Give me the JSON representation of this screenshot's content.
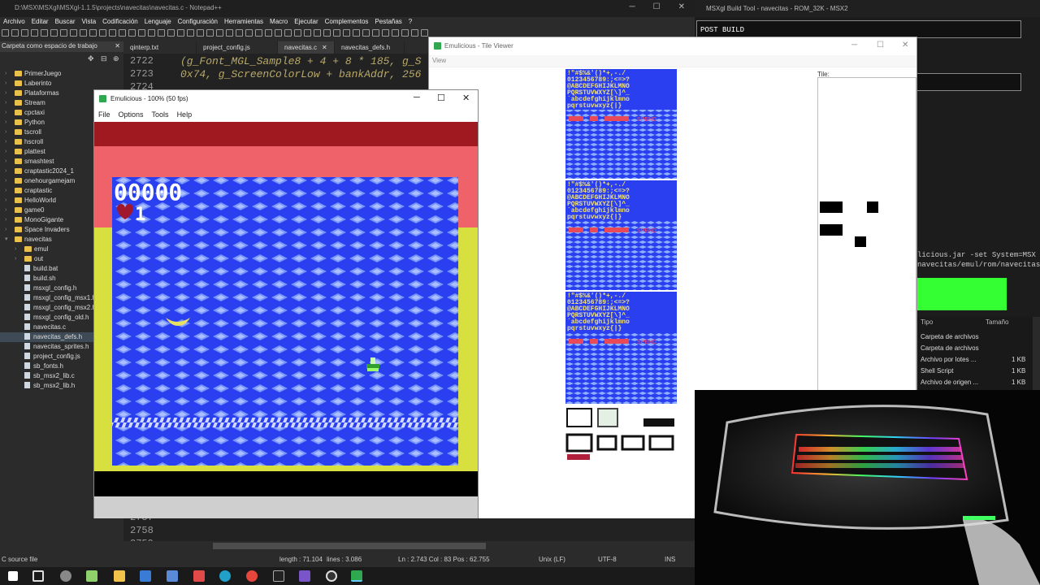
{
  "notepad": {
    "title": "D:\\MSX\\MSXgl\\MSXgl-1.1.5\\projects\\navecitas\\navecitas.c - Notepad++",
    "menu": [
      "Archivo",
      "Editar",
      "Buscar",
      "Vista",
      "Codificación",
      "Lenguaje",
      "Configuración",
      "Herramientas",
      "Macro",
      "Ejecutar",
      "Complementos",
      "Pestañas",
      "?"
    ],
    "workspace_title": "Carpeta como espacio de trabajo",
    "tree": [
      {
        "label": "PrimerJuego",
        "type": "folder",
        "level": 0
      },
      {
        "label": "Laberinto",
        "type": "folder",
        "level": 0
      },
      {
        "label": "Plataformas",
        "type": "folder",
        "level": 0
      },
      {
        "label": "Stream",
        "type": "folder",
        "level": 0
      },
      {
        "label": "cpctaxi",
        "type": "folder",
        "level": 0
      },
      {
        "label": "Python",
        "type": "folder",
        "level": 0
      },
      {
        "label": "tscroll",
        "type": "folder",
        "level": 0
      },
      {
        "label": "hscroll",
        "type": "folder",
        "level": 0
      },
      {
        "label": "plattest",
        "type": "folder",
        "level": 0
      },
      {
        "label": "smashtest",
        "type": "folder",
        "level": 0
      },
      {
        "label": "craptastic2024_1",
        "type": "folder",
        "level": 0
      },
      {
        "label": "onehourgamejam",
        "type": "folder",
        "level": 0
      },
      {
        "label": "craptastic",
        "type": "folder",
        "level": 0
      },
      {
        "label": "HelloWorld",
        "type": "folder",
        "level": 0
      },
      {
        "label": "game0",
        "type": "folder",
        "level": 0
      },
      {
        "label": "MonoGigante",
        "type": "folder",
        "level": 0
      },
      {
        "label": "Space Invaders",
        "type": "folder",
        "level": 0
      },
      {
        "label": "navecitas",
        "type": "folder",
        "level": 0,
        "open": true
      },
      {
        "label": "emul",
        "type": "folder",
        "level": 1
      },
      {
        "label": "out",
        "type": "folder",
        "level": 1
      },
      {
        "label": "build.bat",
        "type": "file",
        "level": 1
      },
      {
        "label": "build.sh",
        "type": "file",
        "level": 1
      },
      {
        "label": "msxgl_config.h",
        "type": "file",
        "level": 1
      },
      {
        "label": "msxgl_config_msx1.h",
        "type": "file",
        "level": 1
      },
      {
        "label": "msxgl_config_msx2.h",
        "type": "file",
        "level": 1
      },
      {
        "label": "msxgl_config_old.h",
        "type": "file",
        "level": 1
      },
      {
        "label": "navecitas.c",
        "type": "file",
        "level": 1
      },
      {
        "label": "navecitas_defs.h",
        "type": "file",
        "level": 1,
        "selected": true
      },
      {
        "label": "navecitas_sprites.h",
        "type": "file",
        "level": 1
      },
      {
        "label": "project_config.js",
        "type": "file",
        "level": 1
      },
      {
        "label": "sb_fonts.h",
        "type": "file",
        "level": 1
      },
      {
        "label": "sb_msx2_lib.c",
        "type": "file",
        "level": 1
      },
      {
        "label": "sb_msx2_lib.h",
        "type": "file",
        "level": 1
      }
    ],
    "tabs": [
      {
        "label": "qinterp.txt",
        "active": false
      },
      {
        "label": "project_config.js",
        "active": false
      },
      {
        "label": "navecitas.c",
        "active": true
      },
      {
        "label": "navecitas_defs.h",
        "active": false
      }
    ],
    "lines": [
      {
        "num": "2722",
        "text": "(g_Font_MGL_Sample8 + 4 + 8 * 185, g_S"
      },
      {
        "num": "2723",
        "text": "0x74, g_ScreenColorLow + bankAddr, 256"
      },
      {
        "num": "2724",
        "text": ""
      }
    ],
    "bottom_lines": [
      {
        "num": "2757"
      },
      {
        "num": "2758"
      },
      {
        "num": "2759"
      }
    ],
    "status": {
      "type": "C source file",
      "length": "length : 71.104",
      "lines": "lines : 3.086",
      "pos": "Ln : 2.743    Col : 83    Pos : 62.755",
      "eol": "Unix (LF)",
      "enc": "UTF-8",
      "mode": "INS"
    }
  },
  "build_tool": {
    "title": "MSXgl Build Tool - navecitas - ROM_32K - MSX2",
    "post_build": "POST BUILD",
    "cmd_line1": "licious.jar  -set System=MSX",
    "cmd_line2": "navecitas/emul/rom/navecitas.",
    "columns": [
      "Tipo",
      "Tamaño"
    ],
    "rows": [
      {
        "tipo": "Carpeta de archivos",
        "size": ""
      },
      {
        "tipo": "Carpeta de archivos",
        "size": ""
      },
      {
        "tipo": "Archivo por lotes ...",
        "size": "1 KB"
      },
      {
        "tipo": "Shell Script",
        "size": "1 KB"
      },
      {
        "tipo": "Archivo de origen ...",
        "size": "1 KB"
      }
    ]
  },
  "emulator": {
    "title": "Emulicious - 100% (50 fps)",
    "menu": [
      "File",
      "Options",
      "Tools",
      "Help"
    ],
    "score": "00000",
    "lives": "1"
  },
  "tile_viewer": {
    "title": "Emulicious - Tile Viewer",
    "menu": "View",
    "tile_label": "Tile:",
    "font_row1": "!\"#$%&'()*+,-./",
    "font_row2": "0123456789:;<=>?",
    "font_row3": "@ABCDEFGHIJKLMNO",
    "font_row4": "PQRSTUVWXYZ[\\]^_",
    "font_row5": "`abcdefghijklmno",
    "font_row6": "pqrstuvwxyz{|}",
    "spend": "SPEND"
  },
  "colors": {
    "game_blue": "#2a3ff0",
    "game_yellow": "#d8e040",
    "game_red": "#e84a5a",
    "game_darkred": "#a01820",
    "green": "#33ff33"
  }
}
